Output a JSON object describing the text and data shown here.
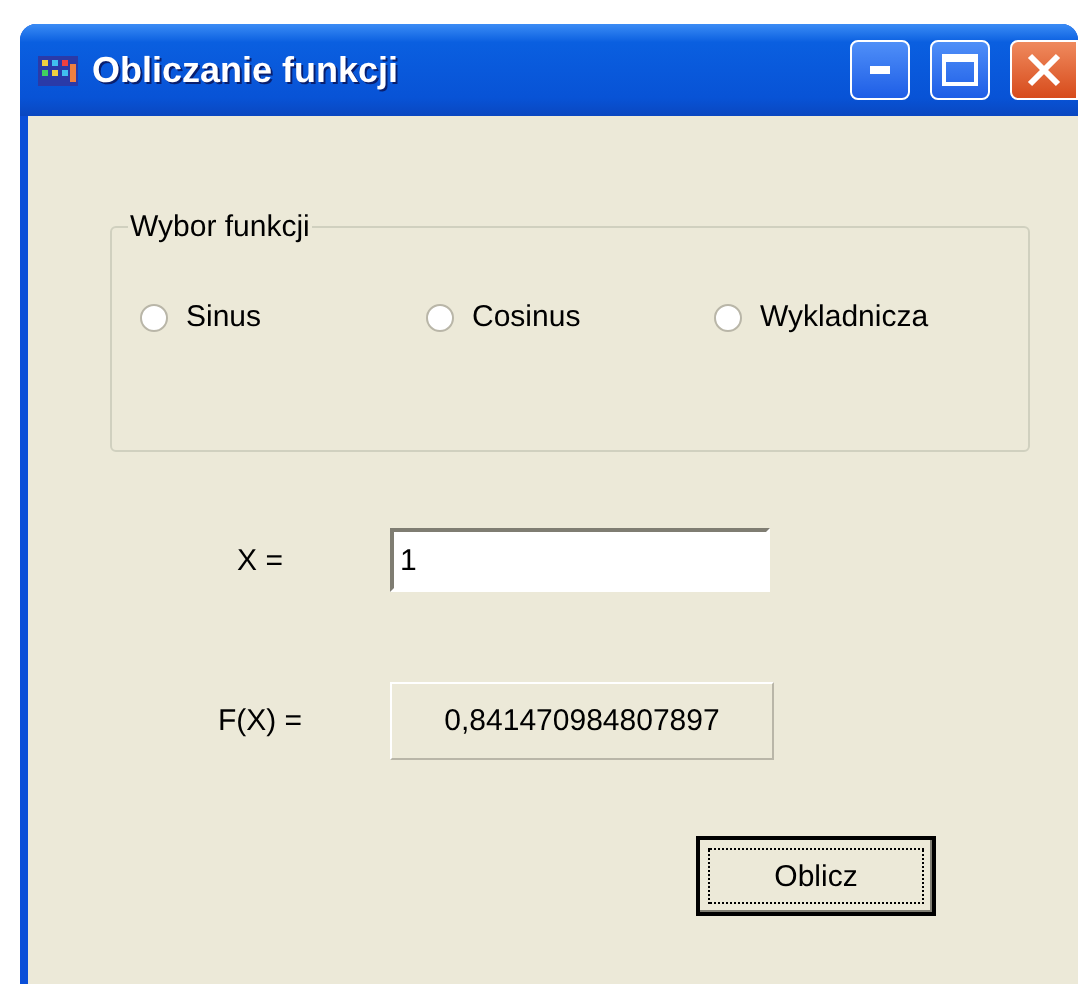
{
  "window": {
    "title": "Obliczanie funkcji"
  },
  "function_group": {
    "title": "Wybor funkcji",
    "options": [
      {
        "label": "Sinus",
        "selected": false
      },
      {
        "label": "Cosinus",
        "selected": false
      },
      {
        "label": "Wykladnicza",
        "selected": false
      }
    ]
  },
  "x_field": {
    "label": "X =",
    "value": "1"
  },
  "result": {
    "label": "F(X) =",
    "value": "0,841470984807897"
  },
  "buttons": [
    {
      "label": "Oblicz",
      "focused": true
    }
  ]
}
